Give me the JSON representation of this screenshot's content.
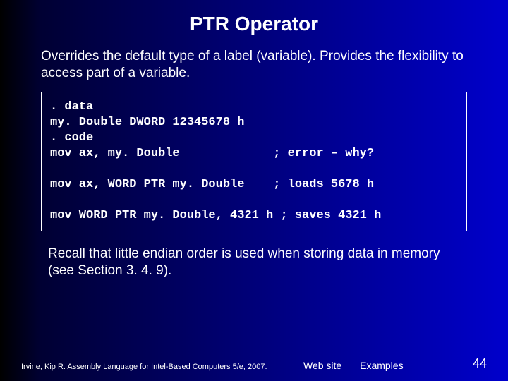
{
  "title": "PTR Operator",
  "intro": "Overrides the default type of a label (variable). Provides the flexibility to access part of a variable.",
  "code": ". data\nmy. Double DWORD 12345678 h\n. code\nmov ax, my. Double             ; error – why?\n\nmov ax, WORD PTR my. Double    ; loads 5678 h\n\nmov WORD PTR my. Double, 4321 h ; saves 4321 h",
  "recall": "Recall that little endian order is used when storing data in memory (see Section 3. 4. 9).",
  "footer": {
    "credit": "Irvine, Kip R. Assembly Language for Intel-Based Computers 5/e, 2007.",
    "links": {
      "website": "Web site",
      "examples": "Examples"
    },
    "page": "44"
  }
}
